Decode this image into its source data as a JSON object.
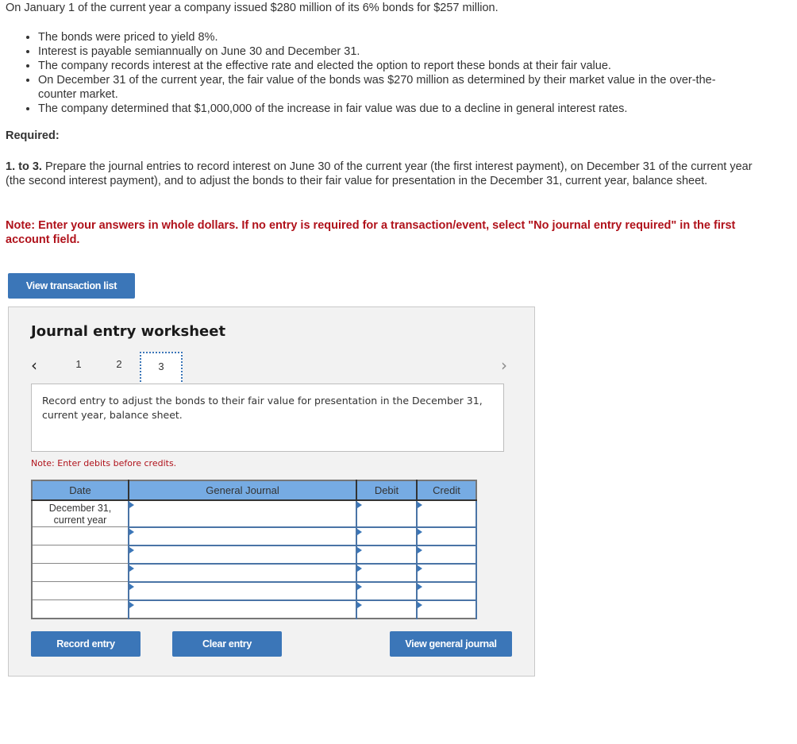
{
  "problem": {
    "intro": "On January 1 of the current year a company issued $280 million of its 6% bonds for $257 million.",
    "bullets": [
      "The bonds were priced to yield 8%.",
      "Interest is payable semiannually on June 30 and December 31.",
      "The company records interest at the effective rate and elected the option to report these bonds at their fair value.",
      "On December 31 of the current year, the fair value of the bonds was $270 million as determined by their market value in the over-the-counter market.",
      "The company determined that $1,000,000 of the increase in fair value was due to a decline in general interest rates."
    ],
    "required_label": "Required:",
    "task_number": "1. to 3.",
    "task_text": " Prepare the journal entries to record interest on June 30 of the current year (the first interest payment), on December 31 of the current year (the second interest payment), and to adjust the bonds to their fair value for presentation in the December 31, current year, balance sheet.",
    "note": "Note: Enter your answers in whole dollars. If no entry is required for a transaction/event, select \"No journal entry required\" in the first account field."
  },
  "buttons": {
    "view_transaction_list": "View transaction list",
    "record_entry": "Record entry",
    "clear_entry": "Clear entry",
    "view_general_journal": "View general journal"
  },
  "worksheet": {
    "title": "Journal entry worksheet",
    "pages": [
      "1",
      "2",
      "3"
    ],
    "current_page": "3",
    "prev_icon": "‹",
    "next_icon": "›",
    "description": "Record entry to adjust the bonds to their fair value for presentation in the December 31, current year, balance sheet.",
    "note_debits": "Note: Enter debits before credits.",
    "table": {
      "headers": [
        "Date",
        "General Journal",
        "Debit",
        "Credit"
      ],
      "rows": [
        {
          "date": "December 31, current year",
          "account": "",
          "debit": "",
          "credit": ""
        },
        {
          "date": "",
          "account": "",
          "debit": "",
          "credit": ""
        },
        {
          "date": "",
          "account": "",
          "debit": "",
          "credit": ""
        },
        {
          "date": "",
          "account": "",
          "debit": "",
          "credit": ""
        },
        {
          "date": "",
          "account": "",
          "debit": "",
          "credit": ""
        },
        {
          "date": "",
          "account": "",
          "debit": "",
          "credit": ""
        }
      ]
    }
  },
  "colors": {
    "button_blue": "#3b76b8",
    "header_blue": "#76abe3",
    "note_red": "#b0121b"
  }
}
